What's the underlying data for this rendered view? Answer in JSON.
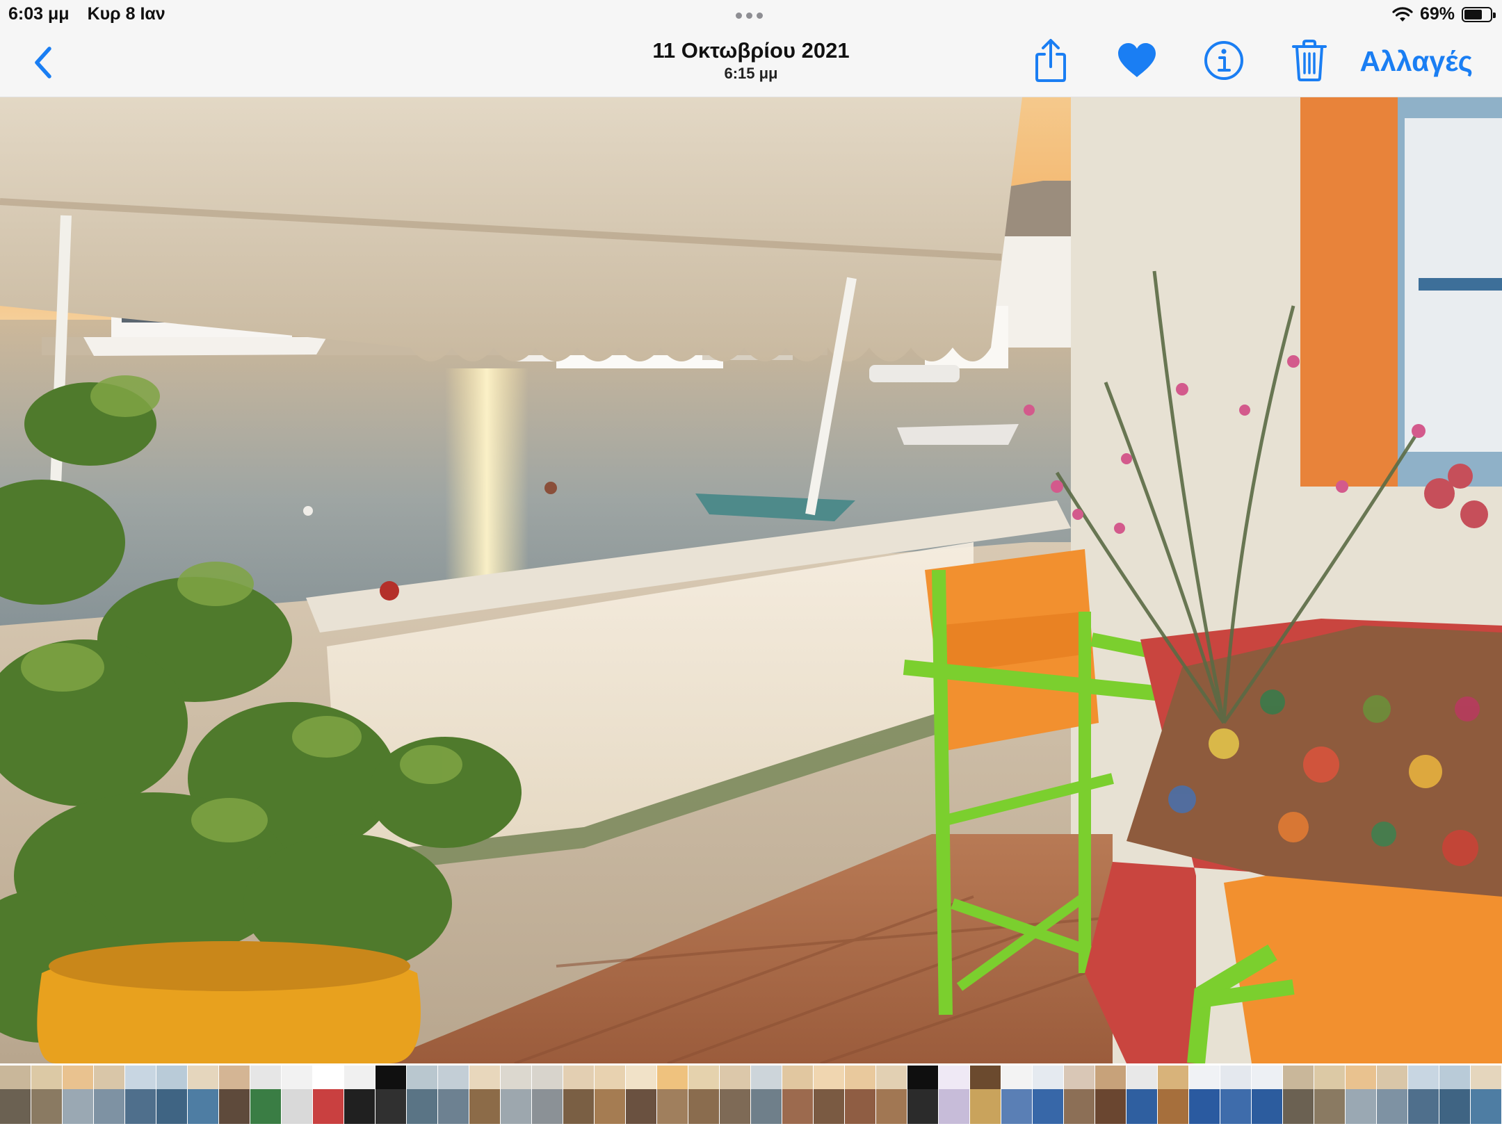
{
  "status_bar": {
    "time": "6:03 μμ",
    "date": "Κυρ 8 Ιαν",
    "battery_percent": "69%",
    "battery_level": 0.69
  },
  "nav": {
    "back_icon": "chevron-left-icon",
    "title_date": "11 Οκτωβρίου 2021",
    "title_time": "6:15 μμ",
    "share_icon": "share-icon",
    "favorite_icon": "heart-icon",
    "favorite_active": true,
    "info_icon": "info-icon",
    "delete_icon": "trash-icon",
    "edit_label": "Αλλαγές",
    "accent_color": "#1a7ef3"
  },
  "photo": {
    "subject": "sunset-harbor-balcony"
  },
  "thumbnails": {
    "current_index": 21,
    "items": [
      {
        "sky": "#c9b79a",
        "sea": "#6b6152"
      },
      {
        "sky": "#dcc9a5",
        "sea": "#8a7a62"
      },
      {
        "sky": "#e9c28f",
        "sea": "#9aa8b3"
      },
      {
        "sky": "#d9c6a8",
        "sea": "#7e92a3"
      },
      {
        "sky": "#c8d6e2",
        "sea": "#4f6f8c"
      },
      {
        "sky": "#b9cbd8",
        "sea": "#3f6483"
      },
      {
        "sky": "#e5d6bd",
        "sea": "#4e7da3"
      },
      {
        "sky": "#d4b594",
        "sea": "#5e4a3b"
      },
      {
        "sky": "#e6e6e6",
        "sea": "#3a7d44"
      },
      {
        "sky": "#f2f2f2",
        "sea": "#d9d9d9"
      },
      {
        "sky": "#ffffff",
        "sea": "#c94040"
      },
      {
        "sky": "#f0f0f0",
        "sea": "#202020"
      },
      {
        "sky": "#101010",
        "sea": "#303030"
      },
      {
        "sky": "#b9c7cf",
        "sea": "#5a7485"
      },
      {
        "sky": "#c3ced6",
        "sea": "#6d8191"
      },
      {
        "sky": "#e8d7bc",
        "sea": "#8c6b48"
      },
      {
        "sky": "#dcd8cf",
        "sea": "#9da7ae"
      },
      {
        "sky": "#d8d4cc",
        "sea": "#8b9196"
      },
      {
        "sky": "#e3cfb2",
        "sea": "#7a5f44"
      },
      {
        "sky": "#e8d2b0",
        "sea": "#a57c52"
      },
      {
        "sky": "#f1e2c8",
        "sea": "#6a5140"
      },
      {
        "sky": "#efc27e",
        "sea": "#a07f5d"
      },
      {
        "sky": "#e5d2ad",
        "sea": "#8a6c4e"
      },
      {
        "sky": "#dcc8aa",
        "sea": "#7e6a56"
      },
      {
        "sky": "#cdd5da",
        "sea": "#6f7f8a"
      },
      {
        "sky": "#e1c7a0",
        "sea": "#9c6a4e"
      },
      {
        "sky": "#f0d6b0",
        "sea": "#7a5a42"
      },
      {
        "sky": "#e9c99d",
        "sea": "#8f5d43"
      },
      {
        "sky": "#e2d0b3",
        "sea": "#a17753"
      },
      {
        "sky": "#0f0f0f",
        "sea": "#2b2b2b"
      },
      {
        "sky": "#efe9f5",
        "sea": "#c7bcd9"
      },
      {
        "sky": "#6b4a2e",
        "sea": "#c9a35c"
      },
      {
        "sky": "#f3f3f3",
        "sea": "#5a7fb5"
      },
      {
        "sky": "#e5eaf0",
        "sea": "#3767a8"
      },
      {
        "sky": "#d9c7b6",
        "sea": "#8c6f56"
      },
      {
        "sky": "#c7a27a",
        "sea": "#6a4630"
      },
      {
        "sky": "#e8e8e8",
        "sea": "#2f5fa0"
      },
      {
        "sky": "#d8b37a",
        "sea": "#a66f3c"
      },
      {
        "sky": "#f0f2f5",
        "sea": "#2a5aa0"
      },
      {
        "sky": "#e4e8ee",
        "sea": "#3e6cab"
      },
      {
        "sky": "#edf0f4",
        "sea": "#2c5c9e"
      }
    ]
  }
}
